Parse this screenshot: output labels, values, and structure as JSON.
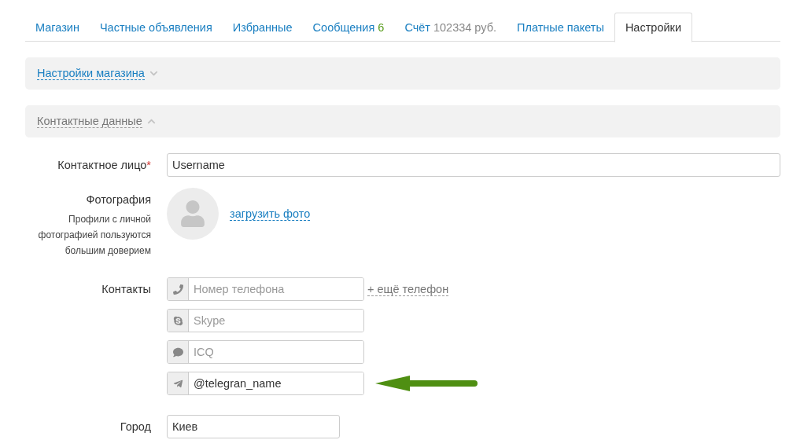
{
  "tabs": [
    {
      "label": "Магазин",
      "selected": false
    },
    {
      "label": "Частные объявления",
      "selected": false
    },
    {
      "label": "Избранные",
      "selected": false
    },
    {
      "label": "Сообщения",
      "extra": {
        "kind": "count",
        "text": "6"
      },
      "selected": false
    },
    {
      "label": "Счёт",
      "extra": {
        "kind": "amount",
        "text": "102334 руб."
      },
      "selected": false
    },
    {
      "label": "Платные пакеты",
      "selected": false
    },
    {
      "label": "Настройки",
      "selected": true
    }
  ],
  "sections": [
    {
      "title": "Настройки магазина",
      "expanded": false
    },
    {
      "title": "Контактные данные",
      "expanded": true
    }
  ],
  "contact_person": {
    "label": "Контактное лицо",
    "required_mark": "*",
    "value": "Username"
  },
  "photo": {
    "label": "Фотография",
    "hint": "Профили с личной фотографией пользуются большим доверием",
    "upload_link": "загрузить фото"
  },
  "contacts": {
    "label": "Контакты",
    "add_link": "+ ещё телефон",
    "fields": [
      {
        "kind": "phone",
        "placeholder": "Номер телефона"
      },
      {
        "kind": "skype",
        "placeholder": "Skype"
      },
      {
        "kind": "icq",
        "placeholder": "ICQ"
      },
      {
        "kind": "telegram",
        "value": "@telegran_name"
      }
    ]
  },
  "city": {
    "label": "Город",
    "value": "Киев"
  }
}
